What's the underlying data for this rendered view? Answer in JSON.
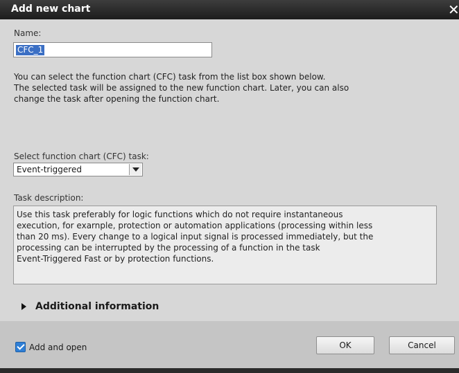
{
  "dialog": {
    "title": "Add new chart",
    "close_glyph": "✕"
  },
  "name": {
    "label": "Name:",
    "value": "CFC_1"
  },
  "intro_lines": [
    "You can select the function chart (CFC) task from the list box shown below.",
    "The selected task will be assigned to the new function chart. Later, you can also",
    "change the task after opening the function chart."
  ],
  "task": {
    "label": "Select function chart (CFC) task:",
    "selected": "Event-triggered"
  },
  "description": {
    "label": "Task description:",
    "lines": [
      "Use this task preferably for logic functions which do not require instantaneous",
      "execution, for exarnple, protection or automation applications (processing within less",
      "than 20 ms). Every change to a logical input signal is processed immediately, but the",
      "processing can be interrupted by the processing of a function in the task",
      "Event-Triggered Fast or by protection functions."
    ]
  },
  "additional_info": {
    "label": "Additional information",
    "expanded": false
  },
  "footer": {
    "add_and_open_label": "Add and open",
    "add_and_open_checked": true,
    "ok_label": "OK",
    "cancel_label": "Cancel"
  },
  "colors": {
    "titlebar": "#2a2a2a",
    "dialog_bg": "#d7d7d7",
    "selection": "#3b6fc4",
    "checkbox": "#2f7fd6"
  }
}
